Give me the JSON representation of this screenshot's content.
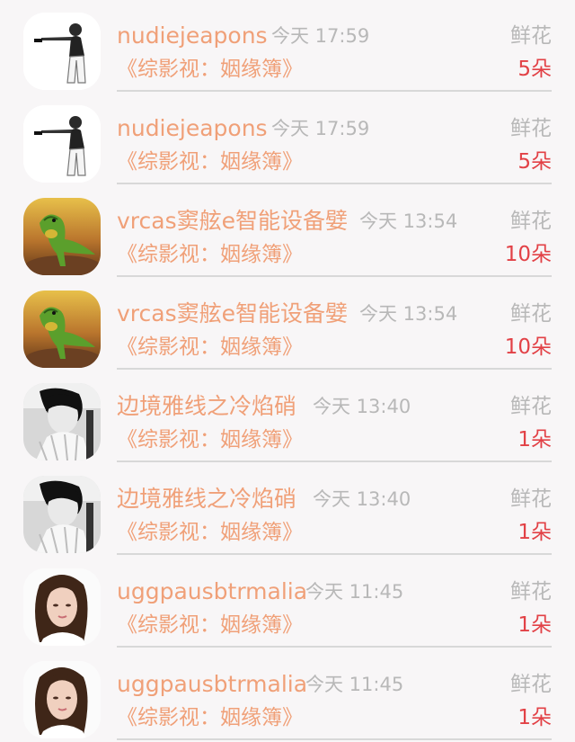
{
  "records": [
    {
      "username": "nudiejeapons",
      "time": "今天 17:59",
      "gift_type": "鲜花",
      "book_title": "《综影视：姻缘簿》",
      "count": "5朵",
      "avatar_icon": "person-pointing-gun-avatar"
    },
    {
      "username": "nudiejeapons",
      "time": "今天 17:59",
      "gift_type": "鲜花",
      "book_title": "《综影视：姻缘簿》",
      "count": "5朵",
      "avatar_icon": "person-pointing-gun-avatar"
    },
    {
      "username": "vrcas窦舷e智能设备嬖",
      "time": "今天 13:54",
      "gift_type": "鲜花",
      "book_title": "《综影视：姻缘簿》",
      "count": "10朵",
      "avatar_icon": "green-dinosaur-avatar"
    },
    {
      "username": "vrcas窦舷e智能设备嬖",
      "time": "今天 13:54",
      "gift_type": "鲜花",
      "book_title": "《综影视：姻缘簿》",
      "count": "10朵",
      "avatar_icon": "green-dinosaur-avatar"
    },
    {
      "username": "边境雅线之冷焰硝",
      "time": "今天 13:40",
      "gift_type": "鲜花",
      "book_title": "《综影视：姻缘簿》",
      "count": "1朵",
      "avatar_icon": "monochrome-person-avatar"
    },
    {
      "username": "边境雅线之冷焰硝",
      "time": "今天 13:40",
      "gift_type": "鲜花",
      "book_title": "《综影视：姻缘簿》",
      "count": "1朵",
      "avatar_icon": "monochrome-person-avatar"
    },
    {
      "username": "uggpausbtrmalia",
      "time": "今天 11:45",
      "gift_type": "鲜花",
      "book_title": "《综影视：姻缘簿》",
      "count": "1朵",
      "avatar_icon": "woman-portrait-avatar"
    },
    {
      "username": "uggpausbtrmalia",
      "time": "今天 11:45",
      "gift_type": "鲜花",
      "book_title": "《综影视：姻缘簿》",
      "count": "1朵",
      "avatar_icon": "woman-portrait-avatar"
    }
  ],
  "colors": {
    "background": "#f8f6f7",
    "username": "#f0a078",
    "book_title": "#f0a078",
    "meta": "#b8b8b8",
    "count": "#e24146",
    "divider": "#d8d8d8"
  }
}
